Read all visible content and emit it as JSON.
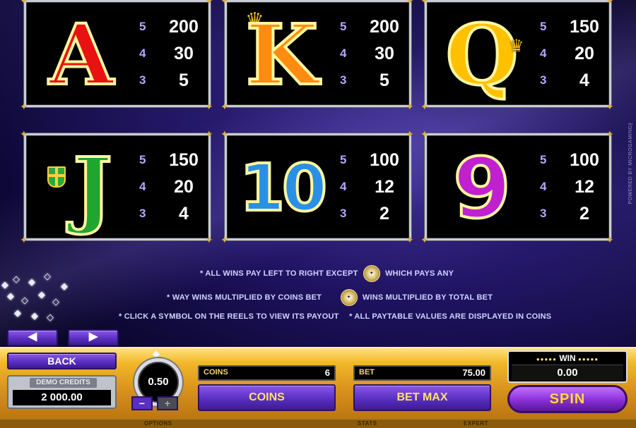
{
  "paytable": [
    {
      "symbol": "A",
      "pays": [
        {
          "n": "5",
          "v": "200"
        },
        {
          "n": "4",
          "v": "30"
        },
        {
          "n": "3",
          "v": "5"
        }
      ]
    },
    {
      "symbol": "K",
      "pays": [
        {
          "n": "5",
          "v": "200"
        },
        {
          "n": "4",
          "v": "30"
        },
        {
          "n": "3",
          "v": "5"
        }
      ]
    },
    {
      "symbol": "Q",
      "pays": [
        {
          "n": "5",
          "v": "150"
        },
        {
          "n": "4",
          "v": "20"
        },
        {
          "n": "3",
          "v": "4"
        }
      ]
    },
    {
      "symbol": "J",
      "pays": [
        {
          "n": "5",
          "v": "150"
        },
        {
          "n": "4",
          "v": "20"
        },
        {
          "n": "3",
          "v": "4"
        }
      ]
    },
    {
      "symbol": "10",
      "pays": [
        {
          "n": "5",
          "v": "100"
        },
        {
          "n": "4",
          "v": "12"
        },
        {
          "n": "3",
          "v": "2"
        }
      ]
    },
    {
      "symbol": "9",
      "pays": [
        {
          "n": "5",
          "v": "100"
        },
        {
          "n": "4",
          "v": "12"
        },
        {
          "n": "3",
          "v": "2"
        }
      ]
    }
  ],
  "rules": {
    "line1_a": "* ALL WINS PAY LEFT TO RIGHT EXCEPT",
    "line1_b": "WHICH PAYS ANY",
    "line2_a": "* WAY WINS MULTIPLIED BY COINS BET",
    "line2_b": "WINS MULTIPLIED BY TOTAL BET",
    "line3_a": "* CLICK A SYMBOL ON THE REELS TO VIEW ITS PAYOUT",
    "line3_b": "* ALL PAYTABLE VALUES ARE DISPLAYED IN COINS"
  },
  "powered_by": "POWERED BY MICROGAMING™",
  "controls": {
    "prev_arrow": "◀",
    "next_arrow": "▶",
    "back_label": "BACK",
    "credits_label": "DEMO CREDITS",
    "credits_value": "2 000.00",
    "coin_size": "0.50",
    "minus": "−",
    "plus": "+",
    "coins_label": "COINS",
    "coins_value": "6",
    "bet_label": "BET",
    "bet_value": "75.00",
    "coins_button": "COINS",
    "bet_max_button": "BET MAX",
    "win_label": "WIN",
    "win_value": "0.00",
    "spin_button": "SPIN"
  },
  "footer": {
    "options": "OPTIONS",
    "stats": "STATS",
    "expert": "EXPERT"
  },
  "colors": {
    "accent_purple": "#5a2fc2",
    "gold_bar": "#f2b72a",
    "background": "#1e1260"
  }
}
